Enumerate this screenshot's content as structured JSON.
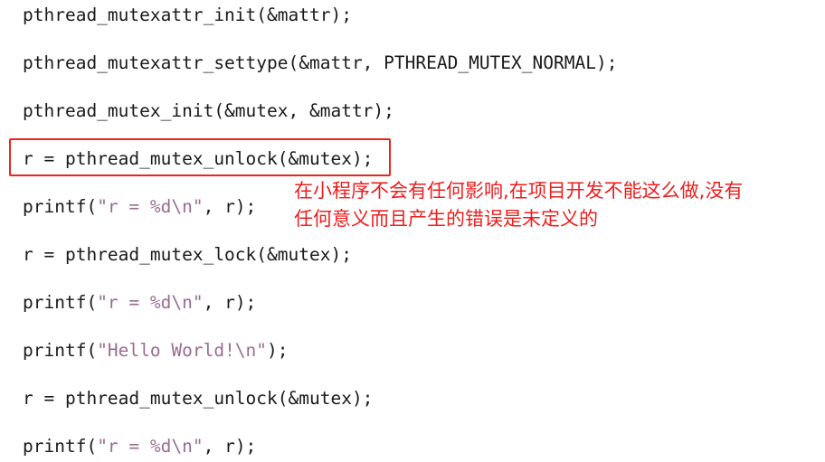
{
  "code": {
    "line1": "pthread_mutexattr_init(&mattr);",
    "line2": "pthread_mutexattr_settype(&mattr, PTHREAD_MUTEX_NORMAL);",
    "line3": "pthread_mutex_init(&mutex, &mattr);",
    "line4": "r = pthread_mutex_unlock(&mutex);",
    "line5": {
      "pre": "printf(",
      "str": "\"r = %d\\n\"",
      "post": ", r);"
    },
    "line6": "r = pthread_mutex_lock(&mutex);",
    "line7": {
      "pre": "printf(",
      "str": "\"r = %d\\n\"",
      "post": ", r);"
    },
    "line8": {
      "pre": "printf(",
      "str": "\"Hello World!\\n\"",
      "post": ");"
    },
    "line9": "r = pthread_mutex_unlock(&mutex);",
    "line10": {
      "pre": "printf(",
      "str": "\"r = %d\\n\"",
      "post": ", r);"
    }
  },
  "annotation": {
    "line1": "在小程序不会有任何影响,在项目开发不能这么做,没有",
    "line2": "任何意义而且产生的错误是未定义的",
    "color": "#ee1d1d"
  },
  "colors": {
    "code_text": "#1a1a1a",
    "string_literal": "#9a6b92",
    "highlight_border": "#e8261e"
  }
}
